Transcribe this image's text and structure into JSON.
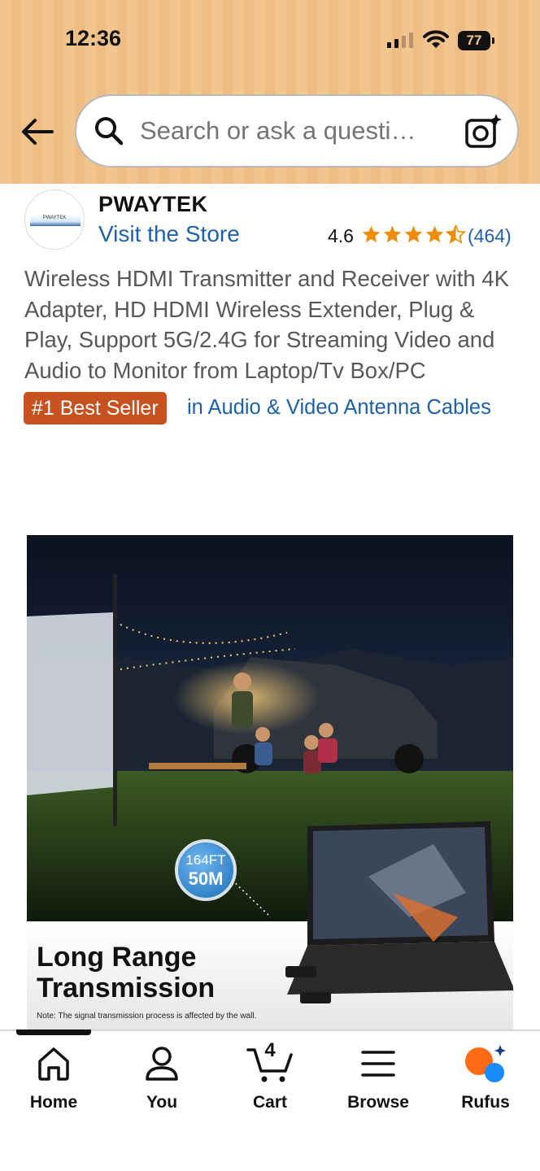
{
  "status_bar": {
    "time": "12:36",
    "battery": "77"
  },
  "search": {
    "placeholder": "Search or ask a questi…"
  },
  "brand": {
    "logo_text": "PWAYTEK",
    "name": "PWAYTEK",
    "store_link": "Visit the Store"
  },
  "rating": {
    "value": "4.6",
    "stars": 4.5,
    "count": "(464)"
  },
  "product": {
    "title": "Wireless HDMI Transmitter and Receiver with 4K Adapter, HD HDMI Wireless Extender, Plug & Play, Support 5G/2.4G for Streaming Video and Audio to Monitor from Laptop/Tv Box/PC",
    "badge": "#1 Best Seller",
    "category": "in Audio & Video Antenna Cables"
  },
  "image": {
    "distance_ft": "164FT",
    "distance_m": "50M",
    "headline_1": "Long Range",
    "headline_2": "Transmission",
    "note": "Note: The signal transmission process is affected by the wall."
  },
  "nav": {
    "home": "Home",
    "you": "You",
    "cart": "Cart",
    "cart_count": "4",
    "browse": "Browse",
    "rufus": "Rufus"
  },
  "colors": {
    "header": "#f3c58e",
    "link": "#1f61a8",
    "badge": "#c7511f",
    "star": "#f08c0a"
  },
  "icons": [
    "back-arrow-icon",
    "search-icon",
    "camera-icon",
    "star-icon",
    "home-icon",
    "person-icon",
    "cart-icon",
    "menu-icon",
    "rufus-icon"
  ]
}
